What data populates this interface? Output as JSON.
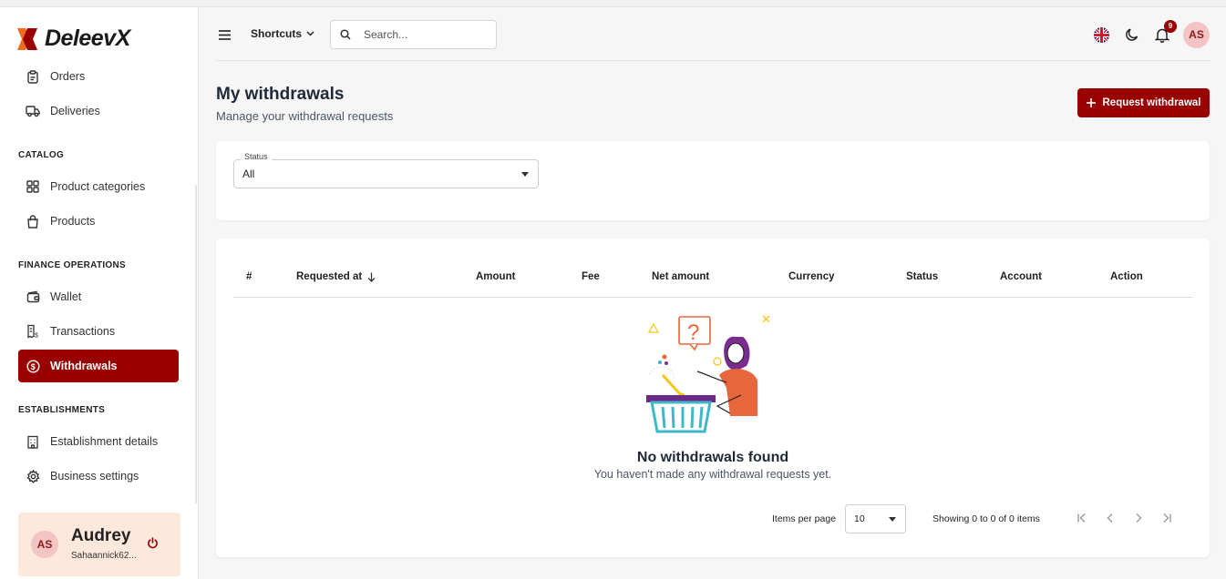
{
  "brand": {
    "name": "DeleevX",
    "accent": "#990000"
  },
  "sidebar": {
    "items_top": [
      {
        "label": "Orders",
        "icon": "clipboard-icon"
      },
      {
        "label": "Deliveries",
        "icon": "truck-icon"
      }
    ],
    "catalog": {
      "title": "CATALOG",
      "items": [
        {
          "label": "Product categories",
          "icon": "grid-icon"
        },
        {
          "label": "Products",
          "icon": "shopping-bag-icon"
        }
      ]
    },
    "finance": {
      "title": "FINANCE OPERATIONS",
      "items": [
        {
          "label": "Wallet",
          "icon": "wallet-icon"
        },
        {
          "label": "Transactions",
          "icon": "receipt-icon"
        },
        {
          "label": "Withdrawals",
          "icon": "dollar-circle-icon",
          "active": true
        }
      ]
    },
    "establishments": {
      "title": "ESTABLISHMENTS",
      "items": [
        {
          "label": "Establishment details",
          "icon": "building-icon"
        },
        {
          "label": "Business settings",
          "icon": "gear-icon"
        }
      ]
    },
    "user": {
      "initials": "AS",
      "name": "Audrey",
      "email": "Sahaannick62..."
    }
  },
  "header": {
    "shortcuts_label": "Shortcuts",
    "search_placeholder": "Search...",
    "notifications_count": "9",
    "avatar_initials": "AS"
  },
  "page": {
    "title": "My withdrawals",
    "subtitle": "Manage your withdrawal requests",
    "request_button": "Request withdrawal"
  },
  "filter": {
    "status_label": "Status",
    "status_value": "All"
  },
  "table": {
    "columns": [
      "#",
      "Requested at",
      "Amount",
      "Fee",
      "Net amount",
      "Currency",
      "Status",
      "Account",
      "Action"
    ],
    "rows": [],
    "empty_title": "No withdrawals found",
    "empty_subtitle": "You haven't made any withdrawal requests yet."
  },
  "pagination": {
    "items_per_page_label": "Items per page",
    "items_per_page_value": "10",
    "showing_text": "Showing 0 to 0 of 0 items"
  }
}
